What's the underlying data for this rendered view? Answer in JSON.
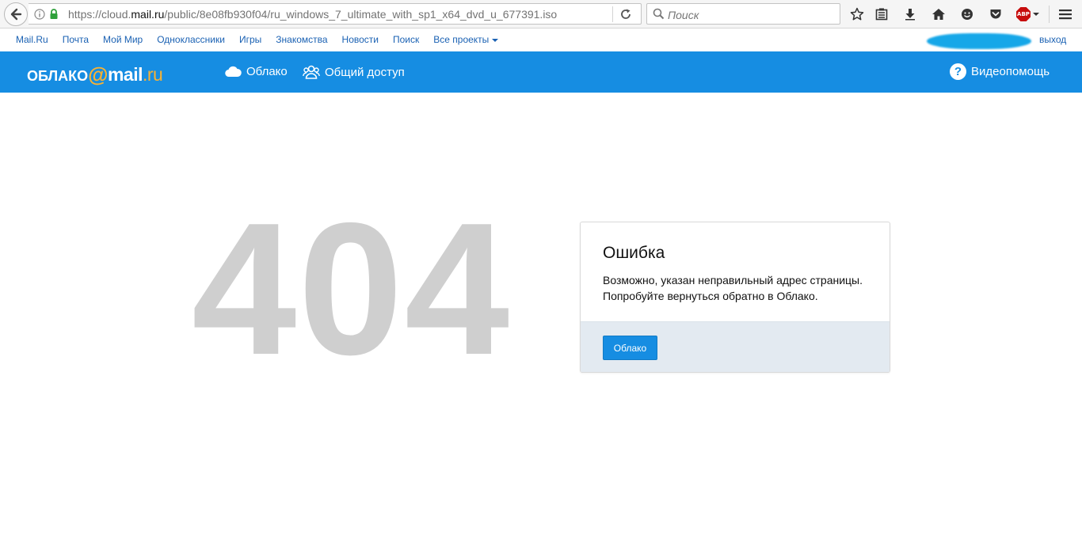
{
  "browser": {
    "url_prefix": "https://cloud.",
    "url_domain": "mail.ru",
    "url_path": "/public/8e08fb930f04/ru_windows_7_ultimate_with_sp1_x64_dvd_u_677391.iso",
    "search_placeholder": "Поиск",
    "adblock_label": "ABP",
    "icons": [
      "back-arrow-icon",
      "info-icon",
      "lock-icon",
      "reload-icon",
      "search-icon",
      "bookmark-star-icon",
      "reading-list-icon",
      "download-icon",
      "home-icon",
      "smiley-icon",
      "pocket-icon",
      "adblock-icon",
      "menu-icon"
    ]
  },
  "portal": {
    "links": [
      "Mail.Ru",
      "Почта",
      "Мой Мир",
      "Одноклассники",
      "Игры",
      "Знакомства",
      "Новости",
      "Поиск",
      "Все проекты"
    ],
    "logout": "выход"
  },
  "header": {
    "logo_cloud": "ОБЛАКО",
    "logo_at": "@",
    "logo_mail": "mail",
    "logo_ru": ".ru",
    "nav_cloud": "Облако",
    "nav_shared": "Общий доступ",
    "help": "Видеопомощь",
    "accent_color": "#168de2",
    "logo_accent_color": "#f9b233"
  },
  "main": {
    "code": "404",
    "card_title": "Ошибка",
    "card_line1": "Возможно, указан неправильный адрес страницы.",
    "card_line2": "Попробуйте вернуться обратно в Облако.",
    "button_label": "Облако"
  }
}
